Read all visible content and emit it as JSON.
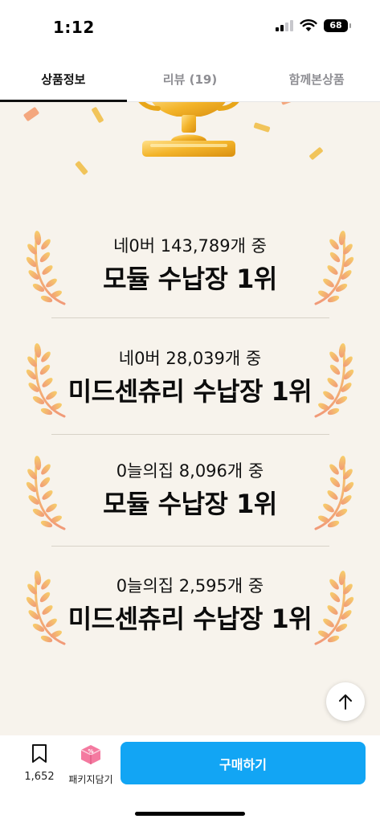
{
  "status_bar": {
    "time": "1:12",
    "battery": "68"
  },
  "tabs": [
    {
      "label": "상품정보",
      "active": true
    },
    {
      "label": "리뷰 (19)",
      "active": false
    },
    {
      "label": "함께본상품",
      "active": false
    }
  ],
  "awards": [
    {
      "subtitle": "네0버 143,789개 중",
      "title": "모듈 수납장 1위"
    },
    {
      "subtitle": "네0버 28,039개 중",
      "title": "미드센츄리 수납장 1위"
    },
    {
      "subtitle": "0늘의집 8,096개 중",
      "title": "모듈 수납장 1위"
    },
    {
      "subtitle": "0늘의집 2,595개 중",
      "title": "미드센츄리 수납장 1위"
    }
  ],
  "bottom_bar": {
    "bookmark_count": "1,652",
    "package_label": "패키지담기",
    "buy_label": "구매하기"
  },
  "colors": {
    "accent": "#12a5f4",
    "content_bg": "#f7f3ec",
    "gold": "#f1b82a",
    "laurel_light": "#f9cf6e",
    "laurel_dark": "#f09d7a"
  },
  "icons": [
    "signal-icon",
    "wifi-icon",
    "battery-icon",
    "trophy-icon",
    "laurel-icon",
    "arrow-up-icon",
    "bookmark-icon",
    "package-box-icon"
  ]
}
